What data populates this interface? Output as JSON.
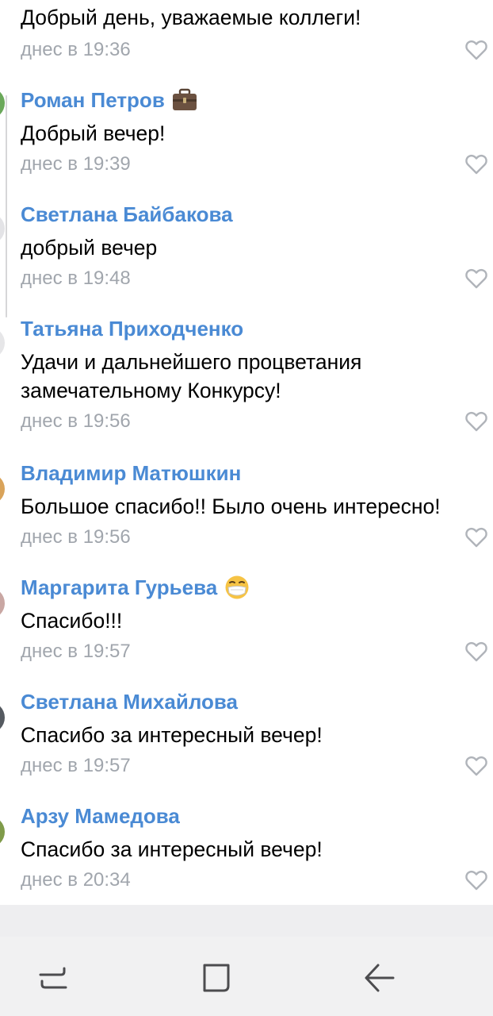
{
  "comments": [
    {
      "author": "",
      "text": "Добрый день, уважаемые коллеги!",
      "time": "днес в 19:36"
    },
    {
      "author": "Роман Петров",
      "badge_icon": "briefcase-icon",
      "text": "Добрый вечер!",
      "time": "днес в 19:39"
    },
    {
      "author": "Светлана Байбакова",
      "text": "добрый вечер",
      "time": "днес в 19:48"
    },
    {
      "author": "Татьяна Приходченко",
      "text": "Удачи и дальнейшего процветания\nзамечательному Конкурсу!",
      "time": "днес в 19:56"
    },
    {
      "author": "Владимир Матюшкин",
      "text": "Большое спасибо!! Было очень интересно!",
      "time": "днес в 19:56"
    },
    {
      "author": "Маргарита Гурьева",
      "badge_icon": "face-with-mask-emoji-icon",
      "text": "Спасибо!!!",
      "time": "днес в 19:57"
    },
    {
      "author": "Светлана Михайлова",
      "text": "Спасибо за интересный вечер!",
      "time": "днес в 19:57"
    },
    {
      "author": "Арзу Мамедова",
      "text": "Спасибо за интересный вечер!",
      "time": "днес в 20:34"
    }
  ],
  "navigation_bar": {
    "buttons": [
      "recent-apps-icon",
      "home-icon",
      "back-icon"
    ]
  },
  "colors": {
    "author_name": "#4a8ad4",
    "timestamp": "#a1a6ad",
    "message_text": "#000000",
    "like_icon": "#b0b4ba",
    "nav_bar_bg": "#f1f1f2"
  }
}
